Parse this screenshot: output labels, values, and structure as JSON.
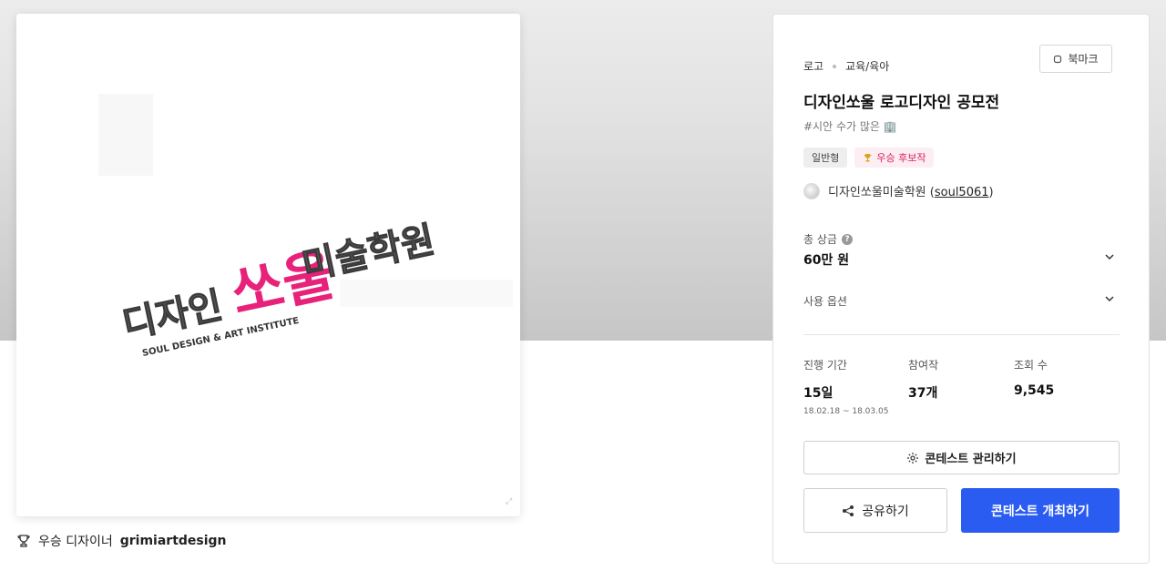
{
  "colors": {
    "primary": "#2b5cf2",
    "logo_pink": "#e8217a",
    "logo_gray": "#555555",
    "winner_badge": "#d9245c"
  },
  "artwork": {
    "logo_main_left": "디자인",
    "logo_main_pink": "쏘울",
    "logo_main_right": "미술학원",
    "logo_sub": "SOUL DESIGN & ART INSTITUTE"
  },
  "winner": {
    "prefix": "우승 디자이너",
    "designer": "grimiartdesign",
    "icon": "trophy-icon"
  },
  "panel": {
    "category": "로고",
    "subcategory": "교육/육아",
    "bookmark_label": "북마크",
    "title": "디자인쏘울 로고디자인 공모전",
    "tagline": "#시안 수가 많은 🏢",
    "badges": [
      {
        "label": "일반형"
      },
      {
        "label": "우승 후보작",
        "icon": "trophy-icon"
      }
    ],
    "host_name": "디자인쏘울미술학원 (",
    "host_handle": "soul5061",
    "host_close": ")",
    "prize_label": "총 상금",
    "prize_value": "60만 원",
    "options_label": "사용 옵션",
    "stats": [
      {
        "label": "진행 기간",
        "value": "15일",
        "sub": "18.02.18 ~ 18.03.05"
      },
      {
        "label": "참여작",
        "value": "37개"
      },
      {
        "label": "조회 수",
        "value": "9,545"
      }
    ],
    "manage_label": "콘테스트 관리하기",
    "share_label": "공유하기",
    "host_contest_label": "콘테스트 개최하기"
  }
}
